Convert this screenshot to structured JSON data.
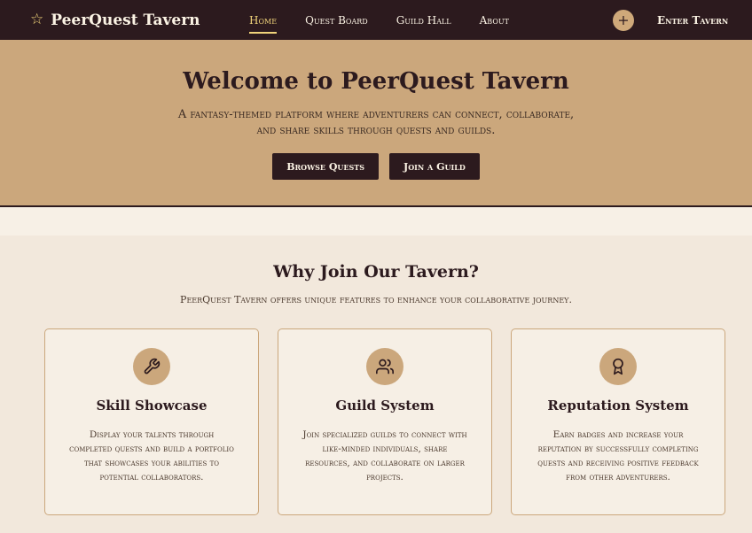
{
  "nav": {
    "brand": "PeerQuest Tavern",
    "links": [
      {
        "label": "Home",
        "active": true
      },
      {
        "label": "Quest Board",
        "active": false
      },
      {
        "label": "Guild Hall",
        "active": false
      },
      {
        "label": "About",
        "active": false
      }
    ],
    "plus": "+",
    "enter": "Enter Tavern"
  },
  "hero": {
    "title": "Welcome to PeerQuest Tavern",
    "subtitle": "A fantasy-themed platform where adventurers can connect, collaborate, and share skills through quests and guilds.",
    "browse": "Browse Quests",
    "join": "Join a Guild"
  },
  "features": {
    "title": "Why Join Our Tavern?",
    "subtitle": "PeerQuest Tavern offers unique features to enhance your collaborative journey.",
    "cards": [
      {
        "icon": "wrench-icon",
        "title": "Skill Showcase",
        "desc": "Display your talents through completed quests and build a portfolio that showcases your abilities to potential collaborators."
      },
      {
        "icon": "users-icon",
        "title": "Guild System",
        "desc": "Join specialized guilds to connect with like-minded individuals, share resources, and collaborate on larger projects."
      },
      {
        "icon": "award-icon",
        "title": "Reputation System",
        "desc": "Earn badges and increase your reputation by successfully completing quests and receiving positive feedback from other adventurers."
      }
    ]
  },
  "colors": {
    "nav_bg": "#2c1a1e",
    "accent_gold": "#f0d37a",
    "hero_bg": "#cba77c",
    "page_bg": "#f2e8dc"
  }
}
